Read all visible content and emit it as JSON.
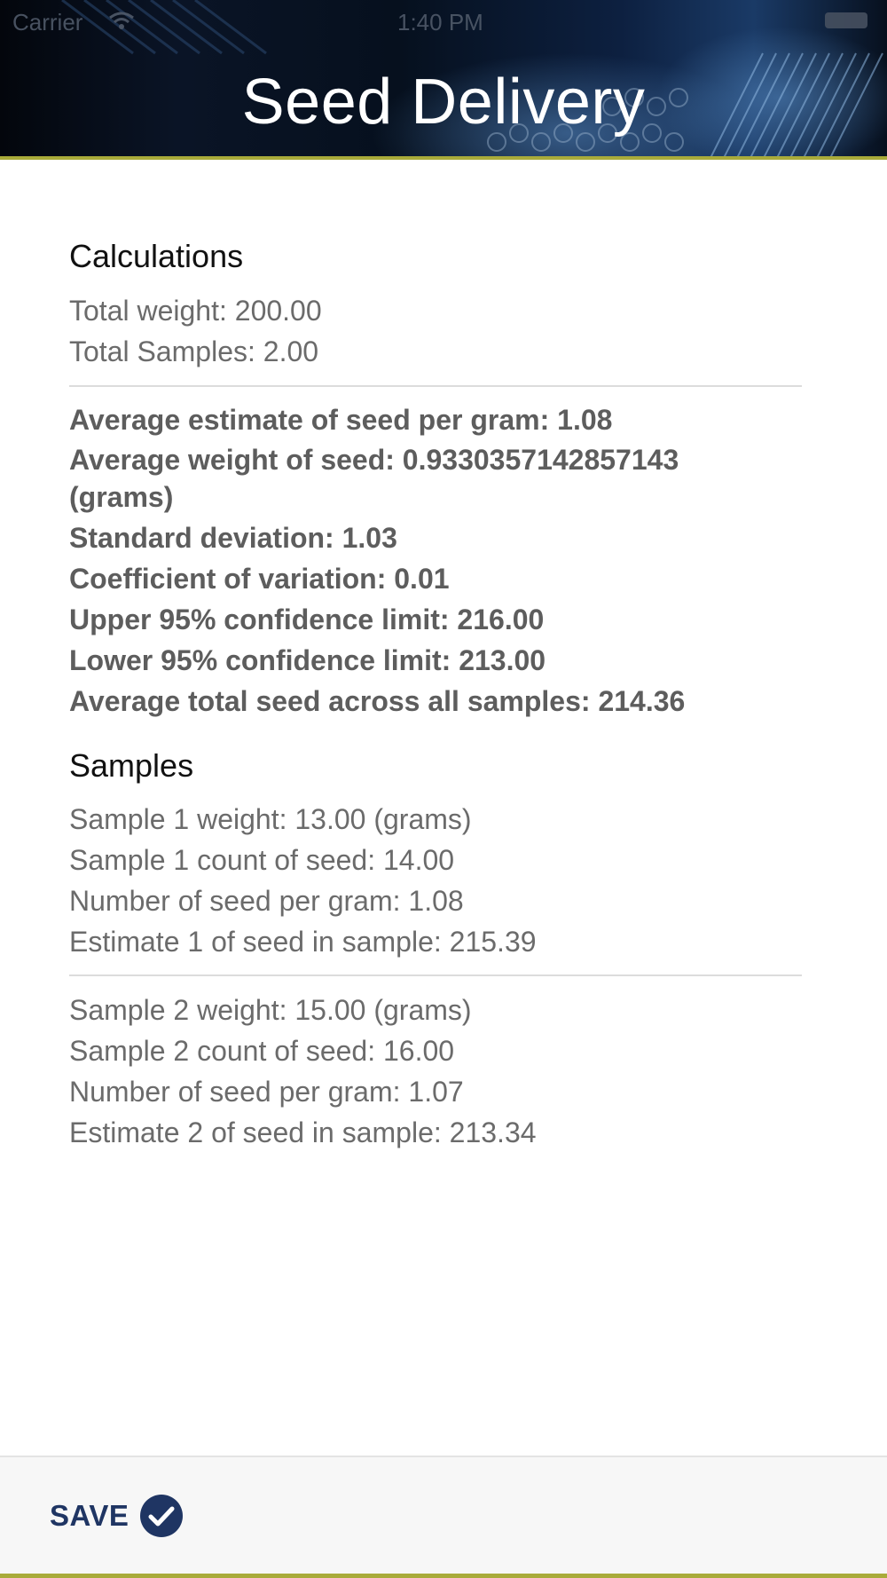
{
  "status_bar": {
    "carrier": "Carrier",
    "time": "1:40 PM"
  },
  "header": {
    "title": "Seed Delivery"
  },
  "calculations": {
    "title": "Calculations",
    "total_weight": "Total weight: 200.00",
    "total_samples": "Total Samples: 2.00",
    "stats": [
      "Average estimate of seed per gram: 1.08",
      "Average weight of seed: 0.9330357142857143 (grams)",
      "Standard deviation: 1.03",
      "Coefficient of variation: 0.01",
      "Upper 95% confidence limit: 216.00",
      "Lower 95% confidence limit: 213.00",
      "Average total seed across all samples: 214.36"
    ]
  },
  "samples": {
    "title": "Samples",
    "items": [
      {
        "weight": "Sample 1 weight: 13.00 (grams)",
        "count": "Sample 1 count of seed: 14.00",
        "per_gram": "Number of seed per gram: 1.08",
        "estimate": "Estimate 1 of seed in sample: 215.39"
      },
      {
        "weight": "Sample 2 weight: 15.00 (grams)",
        "count": "Sample 2 count of seed: 16.00",
        "per_gram": "Number of seed per gram: 1.07",
        "estimate": "Estimate 2 of seed in sample: 213.34"
      }
    ]
  },
  "footer": {
    "save_label": "SAVE",
    "save_icon": "check-circle-icon"
  },
  "colors": {
    "accent": "#a9ab3a",
    "save": "#1f3563",
    "header_bg": "#06101e"
  }
}
